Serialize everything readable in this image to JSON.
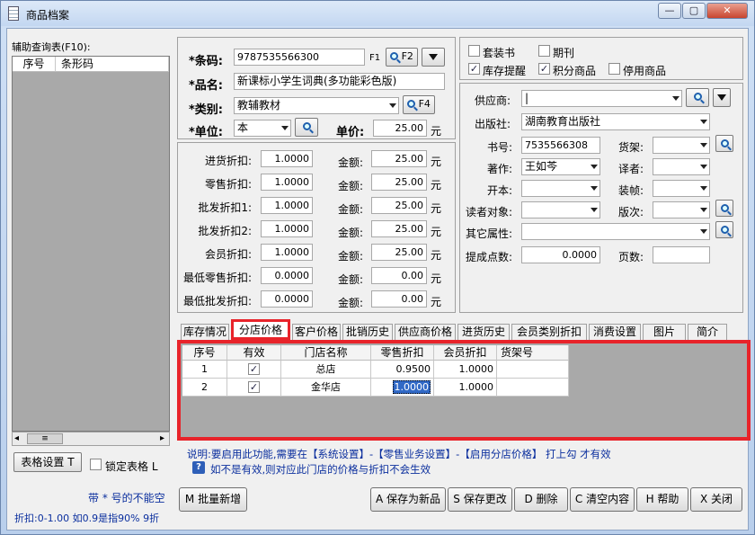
{
  "window": {
    "title": "商品档案",
    "min": "—",
    "max": "▢",
    "close": "✕"
  },
  "left": {
    "title": "辅助查询表(F10):",
    "headers": [
      "序号",
      "条形码"
    ],
    "grid_settings": "表格设置 T",
    "lock_grid": "锁定表格 L",
    "hint_required": "带 * 号的不能空",
    "hint_discount": "折扣:0-1.00 如0.9是指90%  9折",
    "scroll_left": "◂",
    "scroll_right": "▸",
    "scroll_thumb": "≡"
  },
  "basic": {
    "barcode_label": "*条码:",
    "barcode_value": "9787535566300",
    "f1": "F1",
    "f2": "F2",
    "name_label": "*品名:",
    "name_value": "新课标小学生词典(多功能彩色版)",
    "category_label": "*类别:",
    "category_value": "教辅教材",
    "f4": "F4",
    "unit_label": "*单位:",
    "unit_value": "本",
    "price_label": "单价:",
    "price_value": "25.00",
    "currency": "元"
  },
  "pricing": {
    "rows": [
      {
        "label": "进货折扣:",
        "discount": "1.0000",
        "amount_label": "金额:",
        "amount": "25.00",
        "unit": "元"
      },
      {
        "label": "零售折扣:",
        "discount": "1.0000",
        "amount_label": "金额:",
        "amount": "25.00",
        "unit": "元"
      },
      {
        "label": "批发折扣1:",
        "discount": "1.0000",
        "amount_label": "金额:",
        "amount": "25.00",
        "unit": "元"
      },
      {
        "label": "批发折扣2:",
        "discount": "1.0000",
        "amount_label": "金额:",
        "amount": "25.00",
        "unit": "元"
      },
      {
        "label": "会员折扣:",
        "discount": "1.0000",
        "amount_label": "金额:",
        "amount": "25.00",
        "unit": "元"
      },
      {
        "label": "最低零售折扣:",
        "discount": "0.0000",
        "amount_label": "金额:",
        "amount": "0.00",
        "unit": "元"
      },
      {
        "label": "最低批发折扣:",
        "discount": "0.0000",
        "amount_label": "金额:",
        "amount": "0.00",
        "unit": "元"
      }
    ]
  },
  "flags": {
    "set_book": {
      "label": "套装书",
      "checked": false
    },
    "periodical": {
      "label": "期刊",
      "checked": false
    },
    "stock_alert": {
      "label": "库存提醒",
      "checked": true
    },
    "points_item": {
      "label": "积分商品",
      "checked": true
    },
    "disabled_item": {
      "label": "停用商品",
      "checked": false
    },
    "check_mark": "✓"
  },
  "book": {
    "supplier_label": "供应商:",
    "supplier_value": "|",
    "publisher_label": "出版社:",
    "publisher_value": "湖南教育出版社",
    "isbn_label": "书号:",
    "isbn_value": "7535566308",
    "shelf_label": "货架:",
    "shelf_value": "",
    "author_label": "著作:",
    "author_value": "王如芩",
    "translator_label": "译者:",
    "translator_value": "",
    "format_label": "开本:",
    "format_value": "",
    "binding_label": "装帧:",
    "binding_value": "",
    "readers_label": "读者对象:",
    "readers_value": "",
    "edition_label": "版次:",
    "edition_value": "",
    "other_label": "其它属性:",
    "other_value": "",
    "commission_label": "提成点数:",
    "commission_value": "0.0000",
    "pages_label": "页数:",
    "pages_value": ""
  },
  "tabs": [
    {
      "label": "库存情况"
    },
    {
      "label": "分店价格"
    },
    {
      "label": "客户价格"
    },
    {
      "label": "批销历史"
    },
    {
      "label": "供应商价格"
    },
    {
      "label": "进货历史"
    },
    {
      "label": "会员类别折扣"
    },
    {
      "label": "消费设置"
    },
    {
      "label": "图片"
    },
    {
      "label": "简介"
    }
  ],
  "branch_grid": {
    "headers": [
      "序号",
      "有效",
      "门店名称",
      "零售折扣",
      "会员折扣",
      "货架号"
    ],
    "rows": [
      {
        "no": "1",
        "valid": true,
        "store": "总店",
        "retail": "0.9500",
        "member": "1.0000",
        "shelf": ""
      },
      {
        "no": "2",
        "valid": true,
        "store": "金华店",
        "retail": "1.0000",
        "member": "1.0000",
        "shelf": ""
      }
    ]
  },
  "notes": {
    "line1": "说明:要启用此功能,需要在【系统设置】-【零售业务设置】-【启用分店价格】  打上勾 才有效",
    "line2": "如不是有效,则对应此门店的价格与折扣不会生效",
    "help_icon": "?"
  },
  "buttons": {
    "batch_add": "M 批量新增",
    "save_new": "A 保存为新品",
    "save_changes": "S 保存更改",
    "delete": "D 删除",
    "clear": "C 清空内容",
    "help": "H 帮助",
    "close": "X 关闭"
  },
  "colors": {
    "highlight": "#e8232a",
    "selection": "#3169c6"
  }
}
